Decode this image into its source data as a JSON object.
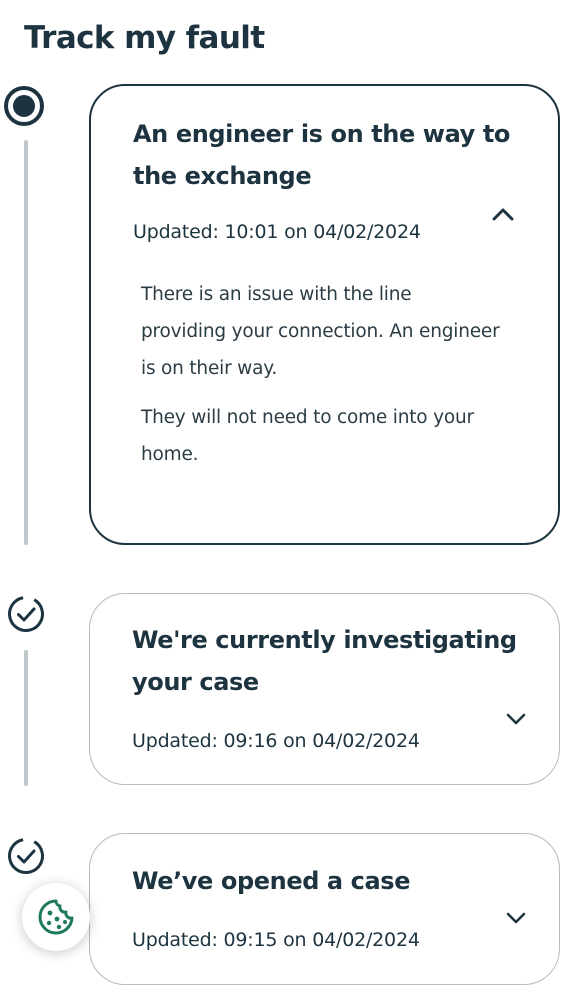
{
  "page": {
    "title": "Track my fault"
  },
  "colors": {
    "primary_text": "#1d3440",
    "rail": "#bfc7cb",
    "inactive_border": "#b3bcc1",
    "cookie_green": "#1f7a57"
  },
  "timeline": [
    {
      "status": "current",
      "title": "An engineer is on the way to the exchange",
      "updated": "Updated: 10:01 on 04/02/2024",
      "expanded": true,
      "toggle_icon": "chevron-up-icon",
      "details": [
        "There is an issue with the line providing your connection. An engineer is on their way.",
        "They will not need to come into your home."
      ]
    },
    {
      "status": "complete",
      "title": "We're currently investigating your case",
      "updated": "Updated: 09:16 on 04/02/2024",
      "expanded": false,
      "toggle_icon": "chevron-down-icon"
    },
    {
      "status": "complete",
      "title": "We’ve opened a case",
      "updated": "Updated: 09:15 on 04/02/2024",
      "expanded": false,
      "toggle_icon": "chevron-down-icon"
    }
  ],
  "cookie_button": {
    "icon": "cookie-icon"
  }
}
